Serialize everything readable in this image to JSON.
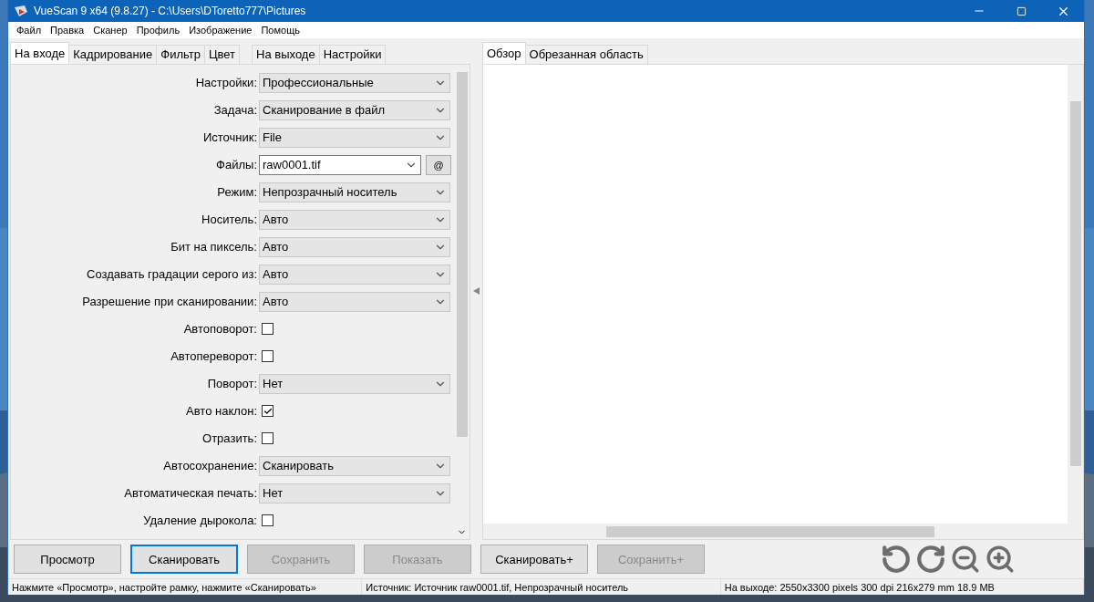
{
  "window": {
    "title": "VueScan 9 x64 (9.8.27) - C:\\Users\\DToretto777\\Pictures"
  },
  "menu": [
    "Файл",
    "Правка",
    "Сканер",
    "Профиль",
    "Изображение",
    "Помощь"
  ],
  "left_tabs": [
    {
      "label": "На входе",
      "selected": true
    },
    {
      "label": "Кадрирование",
      "selected": false
    },
    {
      "label": "Фильтр",
      "selected": false
    },
    {
      "label": "Цвет",
      "selected": false
    },
    {
      "label": "На выходе",
      "selected": false
    },
    {
      "label": "Настройки",
      "selected": false
    }
  ],
  "settings": [
    {
      "kind": "select",
      "label": "Настройки:",
      "value": "Профессиональные"
    },
    {
      "kind": "select",
      "label": "Задача:",
      "value": "Сканирование в файл"
    },
    {
      "kind": "select",
      "label": "Источник:",
      "value": "File"
    },
    {
      "kind": "file",
      "label": "Файлы:",
      "value": "raw0001.tif",
      "button": "@"
    },
    {
      "kind": "select",
      "label": "Режим:",
      "value": "Непрозрачный носитель"
    },
    {
      "kind": "select",
      "label": "Носитель:",
      "value": "Авто"
    },
    {
      "kind": "select",
      "label": "Бит на пиксель:",
      "value": "Авто"
    },
    {
      "kind": "select",
      "label": "Создавать градации серого из:",
      "value": "Авто"
    },
    {
      "kind": "select",
      "label": "Разрешение при сканировании:",
      "value": "Авто"
    },
    {
      "kind": "checkbox",
      "label": "Автоповорот:",
      "checked": false
    },
    {
      "kind": "checkbox",
      "label": "Автопереворот:",
      "checked": false
    },
    {
      "kind": "select",
      "label": "Поворот:",
      "value": "Нет"
    },
    {
      "kind": "checkbox",
      "label": "Авто наклон:",
      "checked": true
    },
    {
      "kind": "checkbox",
      "label": "Отразить:",
      "checked": false
    },
    {
      "kind": "select",
      "label": "Автосохранение:",
      "value": "Сканировать"
    },
    {
      "kind": "select",
      "label": "Автоматическая печать:",
      "value": "Нет"
    },
    {
      "kind": "checkbox",
      "label": "Удаление дырокола:",
      "checked": false
    }
  ],
  "right_tabs": [
    {
      "label": "Обзор",
      "selected": true
    },
    {
      "label": "Обрезанная область",
      "selected": false
    }
  ],
  "buttons": [
    {
      "label": "Просмотр",
      "disabled": false,
      "focused": false
    },
    {
      "label": "Сканировать",
      "disabled": false,
      "focused": true
    },
    {
      "label": "Сохранить",
      "disabled": true,
      "focused": false
    },
    {
      "label": "Показать",
      "disabled": true,
      "focused": false
    },
    {
      "label": "Сканировать+",
      "disabled": false,
      "focused": false
    },
    {
      "label": "Сохранить+",
      "disabled": true,
      "focused": false
    }
  ],
  "status_bar": [
    "Нажмите «Просмотр», настройте рамку, нажмите «Сканировать»",
    "Источник: Источник raw0001.tif, Непрозрачный носитель",
    "На выходе: 2550x3300 pixels 300 dpi 216x279 mm 18.9 MB"
  ]
}
